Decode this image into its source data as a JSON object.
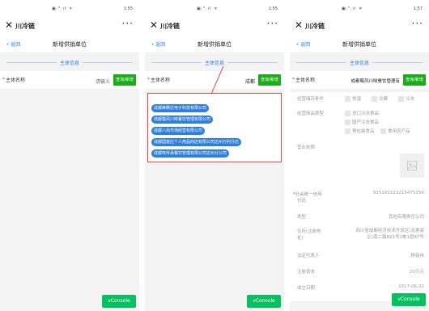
{
  "status": {
    "icons": "▣ᵢᴴ.ıl ᯤ",
    "time_1": "1:55",
    "time_2": "1:55",
    "time_3": "1:57"
  },
  "app": {
    "title": "川冷链",
    "more": "···"
  },
  "nav": {
    "back": "返回",
    "title": "新增供销单位"
  },
  "section": {
    "title": "主体信息"
  },
  "form": {
    "name_label": "主体名称",
    "placeholder": "请输入",
    "query_btn": "查询/新增",
    "value_typed": "成都",
    "value_selected": "成都蜀风川味餐饮管理有"
  },
  "suggestions": [
    "成都蜂腾达电子科技有限公司",
    "成都蜀风川味餐饮管理有限公司",
    "成都八尚市场经营有限公司",
    "成都国富庄个人用品商店有限公司达州万利分店",
    "成都味传承餐饮管理有限公司达州分公司"
  ],
  "details": {
    "storage_label": "经营储存条件",
    "storage_options": [
      "常温",
      "冷藏",
      "冷冻"
    ],
    "category_label": "经营商品类型",
    "category_options": [
      "进口冷冻食品",
      "国产冷冻食品",
      "预包装食品",
      "食用农产品"
    ],
    "license_label": "营业执照",
    "credit_label": "社会统一信用代码",
    "credit_label_1": "社会统一信用",
    "credit_label_2": "代码",
    "credit_value": "91510112321547525K",
    "type_label": "类型",
    "type_value": "其他有限责任公司",
    "address_label": "住所(注册地址)",
    "address_label_1": "住所(注册地",
    "address_label_2": "址)",
    "address_value_1": "四川省成都经济技术开发区(龙泉驿",
    "address_value_2": "区)南二路821号2栋1层87号",
    "rep_label": "法定代表人",
    "rep_value": "杨铭伟",
    "capital_label": "注册资本",
    "capital_value": "20万元",
    "date_label": "成立日期",
    "date_value": "2017-06-22"
  },
  "vconsole": "vConsole",
  "colors": {
    "accent": "#2d7ee0",
    "green": "#07c160",
    "highlight_border": "#e34b4b"
  }
}
